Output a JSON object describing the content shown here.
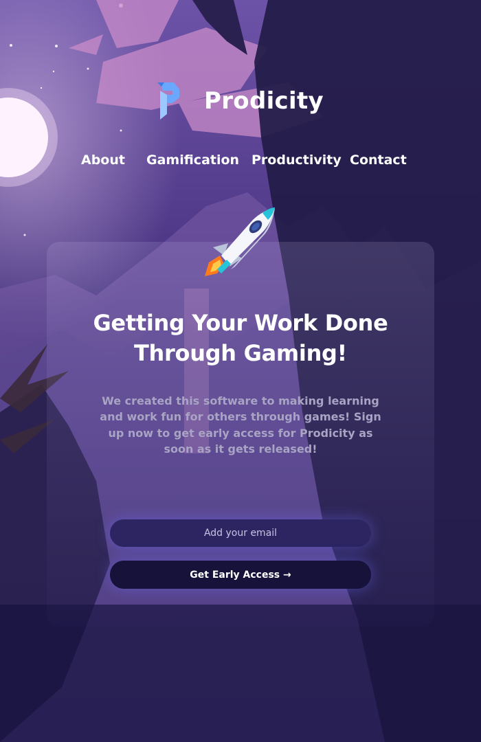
{
  "brand": {
    "name": "Prodicity",
    "logo_icon": "p-logo-icon"
  },
  "nav": {
    "items": [
      {
        "label": "About"
      },
      {
        "label": "Gamification"
      },
      {
        "label": "Productivity"
      },
      {
        "label": "Contact"
      }
    ]
  },
  "hero": {
    "icon": "rocket-icon",
    "headline_line1": "Getting Your Work Done",
    "headline_line2": "Through Gaming!",
    "subtext": "We created this software to making learning and work fun for others through games! Sign up now to get early access for Prodicity as soon as it gets released!"
  },
  "signup": {
    "email_placeholder": "Add your email",
    "email_value": "",
    "button_label": "Get Early Access →"
  },
  "colors": {
    "background_top": "#6c53a8",
    "background_bottom": "#17133f",
    "input_bg": "#2c2562",
    "button_bg": "#16123a",
    "glow": "#6e6eff",
    "logo_blue": "#6aa8ff"
  }
}
